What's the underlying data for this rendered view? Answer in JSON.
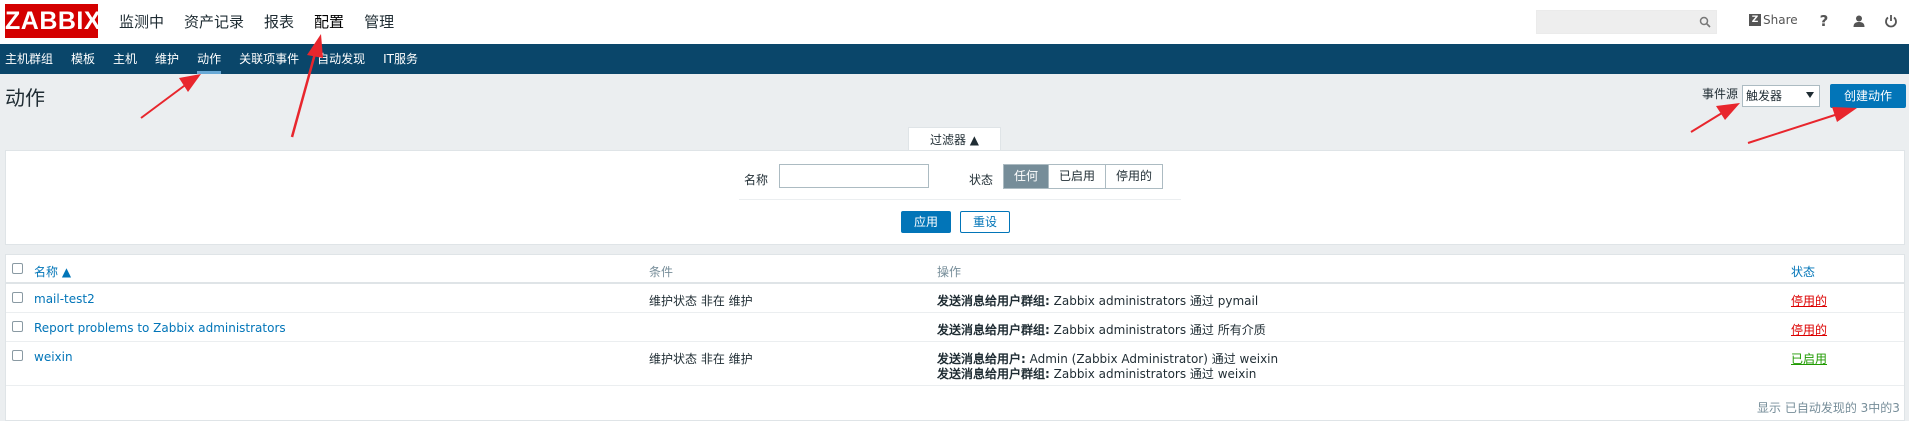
{
  "header": {
    "logo": "ZABBIX",
    "menu": [
      "监测中",
      "资产记录",
      "报表",
      "配置",
      "管理"
    ],
    "active_menu": "配置",
    "search": {
      "value": "",
      "placeholder": ""
    },
    "share_label": "Share",
    "help_label": "?"
  },
  "submenu": {
    "items": [
      "主机群组",
      "模板",
      "主机",
      "维护",
      "动作",
      "关联项事件",
      "自动发现",
      "IT服务"
    ],
    "active": "动作"
  },
  "page": {
    "title": "动作",
    "event_source_label": "事件源",
    "event_source_value": "触发器",
    "create_button": "创建动作"
  },
  "filter": {
    "tab_label": "过滤器 ▲",
    "name_label": "名称",
    "name_value": "",
    "status_label": "状态",
    "status_options": [
      "任何",
      "已启用",
      "停用的"
    ],
    "status_selected": "任何",
    "apply_label": "应用",
    "reset_label": "重设"
  },
  "table": {
    "columns": {
      "name": "名称 ▲",
      "conditions": "条件",
      "operations": "操作",
      "status": "状态"
    },
    "rows": [
      {
        "name": "mail-test2",
        "condition": "维护状态 非在 维护",
        "operations": [
          {
            "label": "发送消息给用户群组:",
            "text": " Zabbix administrators 通过 pymail"
          }
        ],
        "status": "停用的"
      },
      {
        "name": "Report problems to Zabbix administrators",
        "condition": "",
        "operations": [
          {
            "label": "发送消息给用户群组:",
            "text": " Zabbix administrators 通过 所有介质"
          }
        ],
        "status": "停用的"
      },
      {
        "name": "weixin",
        "condition": "维护状态 非在 维护",
        "operations": [
          {
            "label": "发送消息给用户:",
            "text": " Admin (Zabbix Administrator) 通过 weixin"
          },
          {
            "label": "发送消息给用户群组:",
            "text": " Zabbix administrators 通过 weixin"
          }
        ],
        "status": "已启用"
      }
    ],
    "footer": "显示 已自动发现的 3中的3"
  },
  "colors": {
    "brand_red": "#d40000",
    "nav_blue": "#0a466a",
    "primary_button": "#0275b8",
    "status_disabled": "#dc0000",
    "status_enabled": "#1f9a00",
    "annotation_arrow": "#e8262d"
  }
}
